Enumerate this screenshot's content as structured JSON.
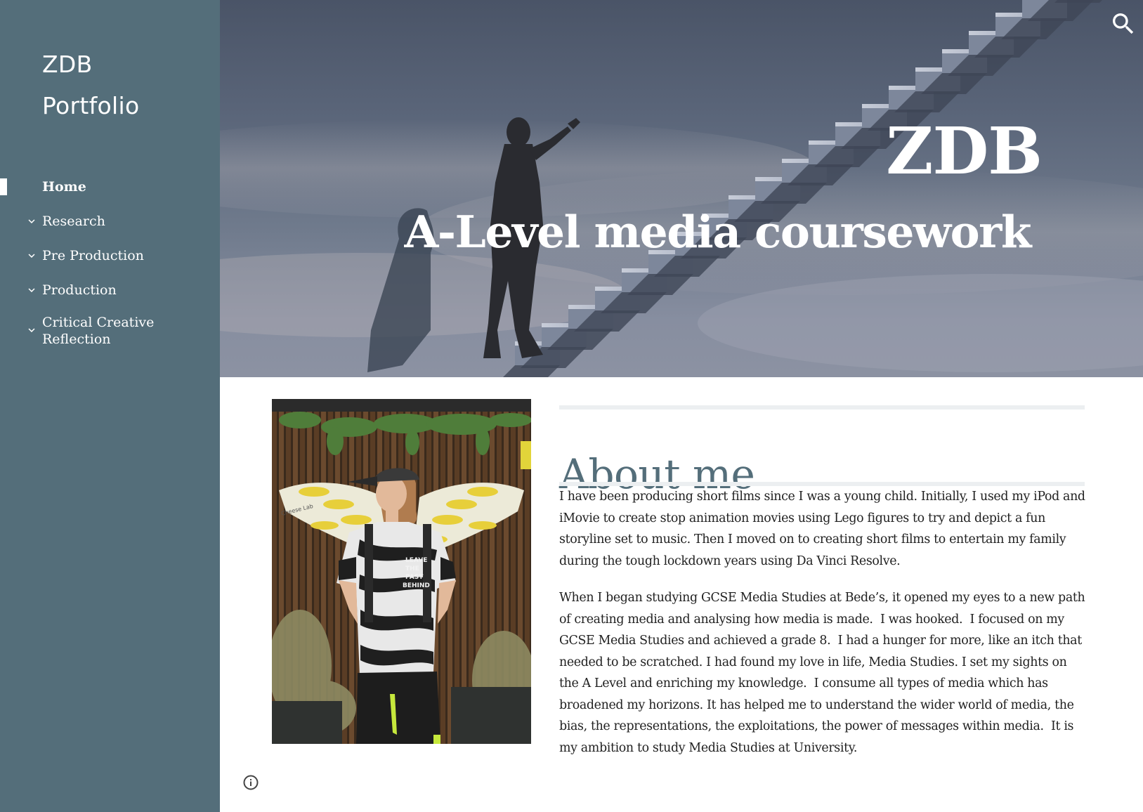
{
  "site": {
    "title_line1": "ZDB",
    "title_line2": "Portfolio"
  },
  "nav": {
    "items": [
      {
        "label": "Home",
        "active": true,
        "expandable": false
      },
      {
        "label": "Research",
        "active": false,
        "expandable": true
      },
      {
        "label": "Pre Production",
        "active": false,
        "expandable": true
      },
      {
        "label": "Production",
        "active": false,
        "expandable": true
      },
      {
        "label": "Critical Creative Reflection",
        "active": false,
        "expandable": true
      }
    ]
  },
  "header": {
    "title": "ZDB",
    "subtitle": "A-Level media coursework",
    "search_icon": "search-icon"
  },
  "main": {
    "heading": "About me",
    "paragraphs": [
      "I have been producing short films since I was a young child. Initially, I used my iPod and iMovie to create stop animation movies using Lego figures to try and depict a fun storyline set to music. Then I moved on to creating short films to entertain my family during the tough lockdown years using Da Vinci Resolve.",
      "When I began studying GCSE Media Studies at Bede’s, it opened my eyes to a new path of creating media and analysing how media is made.  I was hooked.  I focused on my GCSE Media Studies and achieved a grade 8.  I had a hunger for more, like an itch that needed to be scratched. I had found my love in life, Media Studies. I set my sights on the A Level and enriching my knowledge.  I consume all types of media which has broadened my horizons. It has helped me to understand the wider world of media, the bias, the representations, the exploitations, the power of messages within media.  It is my ambition to study Media Studies at University."
    ],
    "photo_tshirt_text": [
      "LEAVE",
      "THE",
      "PAST",
      "BEHIND"
    ],
    "photo_sign_text": "Cheese Lab"
  },
  "footer": {
    "info_icon": "info-icon"
  },
  "colors": {
    "sidebar": "#546e7a",
    "heading": "#546e7a",
    "divider": "#eceff1",
    "body_text": "#212121"
  }
}
